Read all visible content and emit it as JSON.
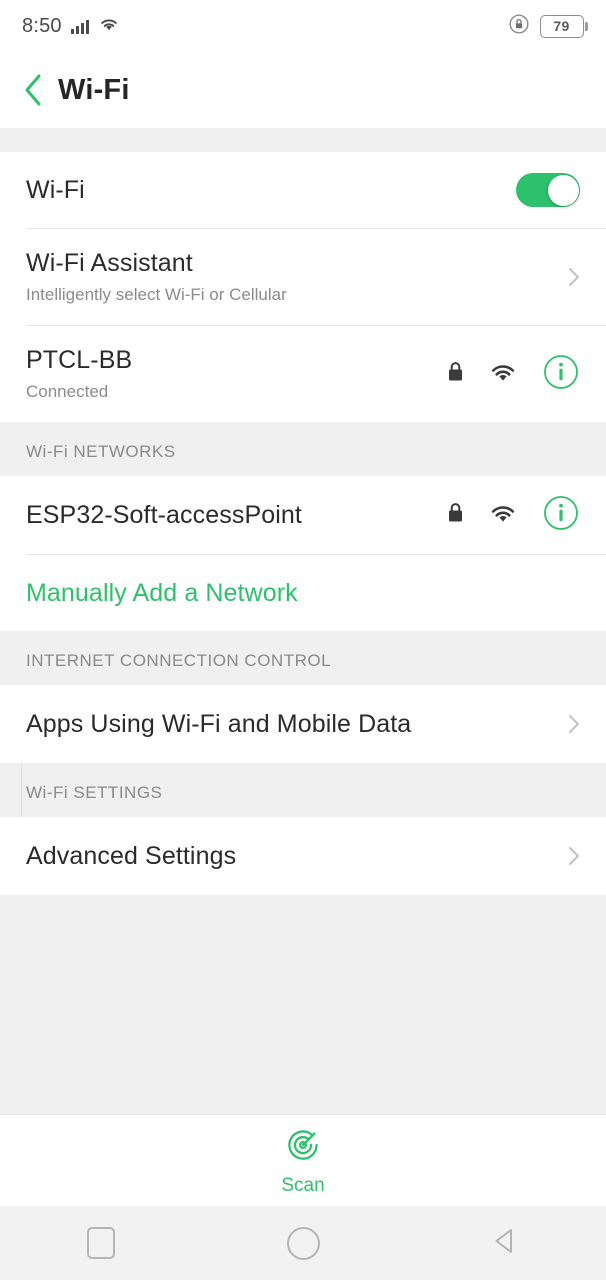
{
  "status_bar": {
    "time": "8:50",
    "signal_icon": "cellular-signal-icon",
    "wifi_icon": "wifi-icon",
    "lock_icon": "screen-lock-rotation-icon",
    "battery_percent": "79"
  },
  "header": {
    "back_icon": "back-chevron-icon",
    "title": "Wi-Fi"
  },
  "wifi_toggle_row": {
    "label": "Wi-Fi",
    "enabled": true
  },
  "assistant_row": {
    "title": "Wi-Fi Assistant",
    "subtitle": "Intelligently select Wi-Fi or Cellular",
    "chevron_icon": "chevron-right-icon"
  },
  "connected_network": {
    "ssid": "PTCL-BB",
    "status": "Connected",
    "lock_icon": "lock-icon",
    "signal_icon": "wifi-signal-icon",
    "info_icon": "info-circle-icon"
  },
  "networks_section": {
    "header": "Wi-Fi NETWORKS",
    "items": [
      {
        "ssid": "ESP32-Soft-accessPoint",
        "lock_icon": "lock-icon",
        "signal_icon": "wifi-signal-icon",
        "info_icon": "info-circle-icon"
      }
    ],
    "manual_add_label": "Manually Add a Network"
  },
  "internet_section": {
    "header": "INTERNET CONNECTION CONTROL",
    "items": [
      {
        "label": "Apps Using Wi-Fi and Mobile Data",
        "chevron_icon": "chevron-right-icon"
      }
    ]
  },
  "settings_section": {
    "header": "Wi-Fi SETTINGS",
    "items": [
      {
        "label": "Advanced Settings",
        "chevron_icon": "chevron-right-icon"
      }
    ]
  },
  "scan_bar": {
    "icon": "radar-scan-icon",
    "label": "Scan"
  },
  "nav_bar": {
    "recents_icon": "recents-square-icon",
    "home_icon": "home-circle-icon",
    "back_icon": "back-triangle-icon"
  },
  "colors": {
    "accent_green": "#2ec16b",
    "page_bg": "#f0f0f0",
    "card_bg": "#ffffff",
    "primary_text": "#2b2b2b",
    "secondary_text": "#8c8c8c"
  }
}
